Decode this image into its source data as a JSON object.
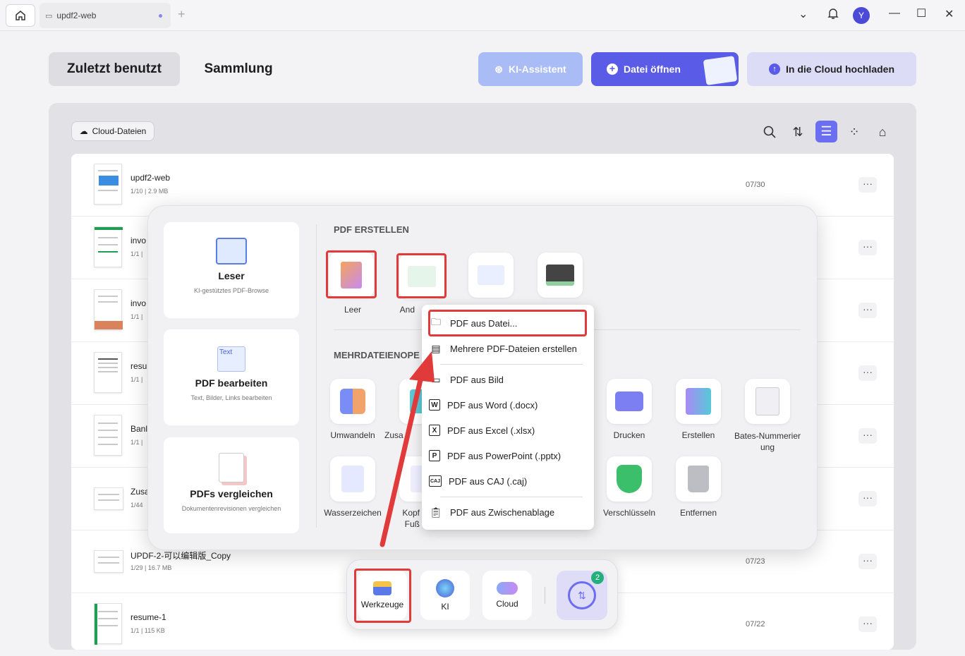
{
  "titlebar": {
    "tab_title": "updf2-web",
    "avatar_initial": "Y"
  },
  "header": {
    "tab_recent": "Zuletzt benutzt",
    "tab_collection": "Sammlung",
    "ai_button": "KI-Assistent",
    "open_button": "Datei öffnen",
    "upload_button": "In die Cloud hochladen"
  },
  "toolbar": {
    "cloud_files": "Cloud-Dateien"
  },
  "files": [
    {
      "name": "updf2-web",
      "meta": "1/10 | 2.9 MB",
      "date": "07/30"
    },
    {
      "name": "invo",
      "meta": "1/1 |",
      "date": ""
    },
    {
      "name": "invo",
      "meta": "1/1 |",
      "date": ""
    },
    {
      "name": "resu",
      "meta": "1/1 |",
      "date": ""
    },
    {
      "name": "Banl",
      "meta": "1/1 |",
      "date": ""
    },
    {
      "name": "Zusa",
      "meta": "1/44",
      "date": ""
    },
    {
      "name": "UPDF-2-可以编辑版_Copy",
      "meta": "1/29 | 16.7 MB",
      "date": "07/23"
    },
    {
      "name": "resume-1",
      "meta": "1/1 | 115 KB",
      "date": "07/22"
    }
  ],
  "cards": [
    {
      "title": "Leser",
      "subtitle": "KI-gestütztes PDF-Browse"
    },
    {
      "title": "PDF bearbeiten",
      "subtitle": "Text, Bilder, Links bearbeiten"
    },
    {
      "title": "PDFs vergleichen",
      "subtitle": "Dokumentenrevisionen vergleichen"
    }
  ],
  "create": {
    "section": "PDF ERSTELLEN",
    "leer": "Leer",
    "and": "And"
  },
  "multi": {
    "section": "MEHRDATEIENOPE",
    "umwandeln": "Umwandeln",
    "zusa": "Zusa",
    "drucken": "Drucken",
    "erstellen": "Erstellen",
    "bates": "Bates-Nummerier ung",
    "wasserzeichen": "Wasserzeichen",
    "kopf": "Kopf",
    "fuss": "Fuß",
    "verschluesseln": "Verschlüsseln",
    "entfernen": "Entfernen"
  },
  "dropdown": {
    "items": [
      "PDF aus Datei...",
      "Mehrere PDF-Dateien erstellen",
      "PDF aus Bild",
      "PDF aus Word (.docx)",
      "PDF aus Excel (.xlsx)",
      "PDF aus PowerPoint (.pptx)",
      "PDF aus CAJ (.caj)",
      "PDF aus Zwischenablage"
    ]
  },
  "dock": {
    "tools": "Werkzeuge",
    "ai": "KI",
    "cloud": "Cloud",
    "badge": "2"
  },
  "colors": {
    "accent": "#5a5ce8",
    "red": "#e03a3a"
  }
}
